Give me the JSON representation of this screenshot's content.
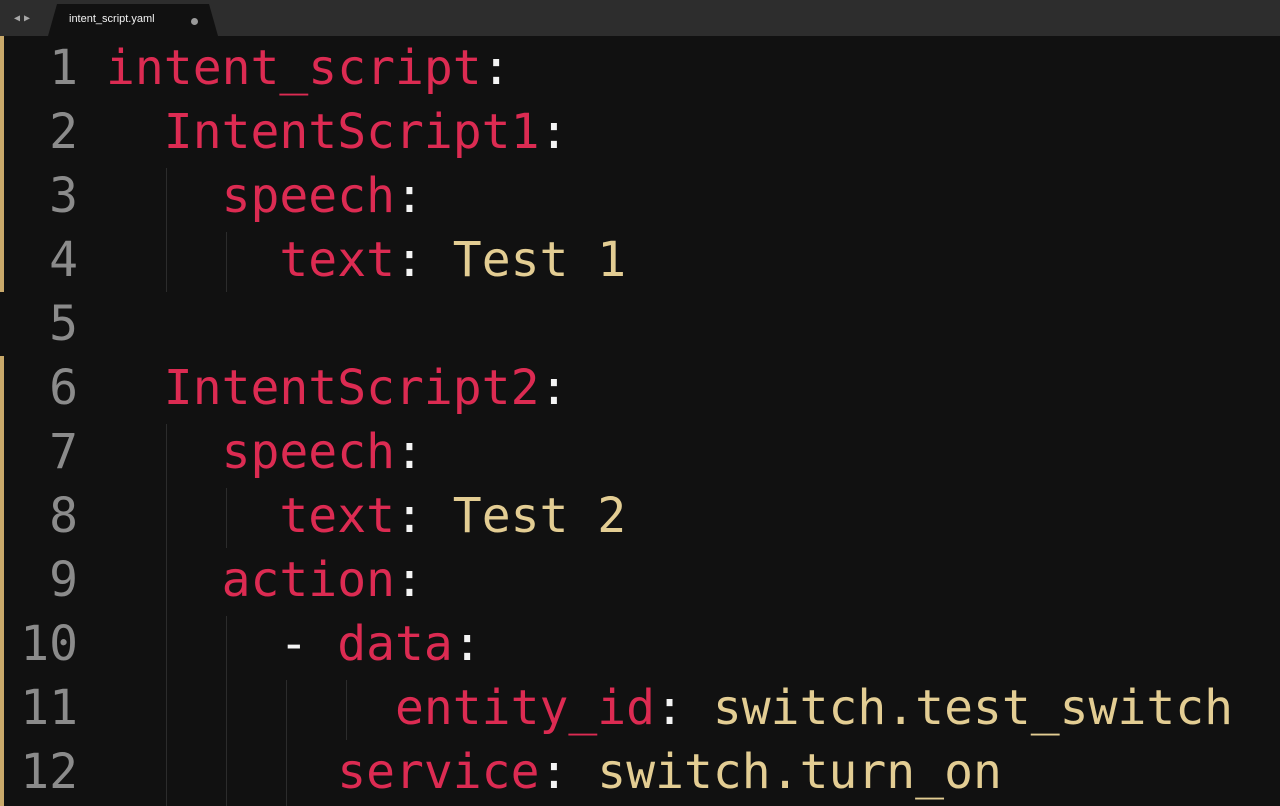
{
  "tab": {
    "back_icon": "◀",
    "forward_icon": "▶",
    "filename": "intent_script.yaml",
    "unsaved_indicator": "dirty-dot-icon"
  },
  "colors": {
    "background": "#111111",
    "key": "#dc2b52",
    "punctuation": "#f4f4f4",
    "value": "#e3cd93",
    "line_number": "#8b8b8b",
    "modified_marker": "#c9a96a"
  },
  "lines": [
    {
      "num": "1",
      "indent": "",
      "dash": "",
      "key": "intent_script",
      "colon": ":",
      "value": ""
    },
    {
      "num": "2",
      "indent": "  ",
      "dash": "",
      "key": "IntentScript1",
      "colon": ":",
      "value": ""
    },
    {
      "num": "3",
      "indent": "    ",
      "dash": "",
      "key": "speech",
      "colon": ":",
      "value": ""
    },
    {
      "num": "4",
      "indent": "      ",
      "dash": "",
      "key": "text",
      "colon": ":",
      "value": " Test 1"
    },
    {
      "num": "5",
      "indent": "",
      "dash": "",
      "key": "",
      "colon": "",
      "value": ""
    },
    {
      "num": "6",
      "indent": "  ",
      "dash": "",
      "key": "IntentScript2",
      "colon": ":",
      "value": ""
    },
    {
      "num": "7",
      "indent": "    ",
      "dash": "",
      "key": "speech",
      "colon": ":",
      "value": ""
    },
    {
      "num": "8",
      "indent": "      ",
      "dash": "",
      "key": "text",
      "colon": ":",
      "value": " Test 2"
    },
    {
      "num": "9",
      "indent": "    ",
      "dash": "",
      "key": "action",
      "colon": ":",
      "value": ""
    },
    {
      "num": "10",
      "indent": "      ",
      "dash": "- ",
      "key": "data",
      "colon": ":",
      "value": ""
    },
    {
      "num": "11",
      "indent": "          ",
      "dash": "",
      "key": "entity_id",
      "colon": ":",
      "value": " switch.test_switch"
    },
    {
      "num": "12",
      "indent": "        ",
      "dash": "",
      "key": "service",
      "colon": ":",
      "value": " switch.turn_on"
    }
  ]
}
